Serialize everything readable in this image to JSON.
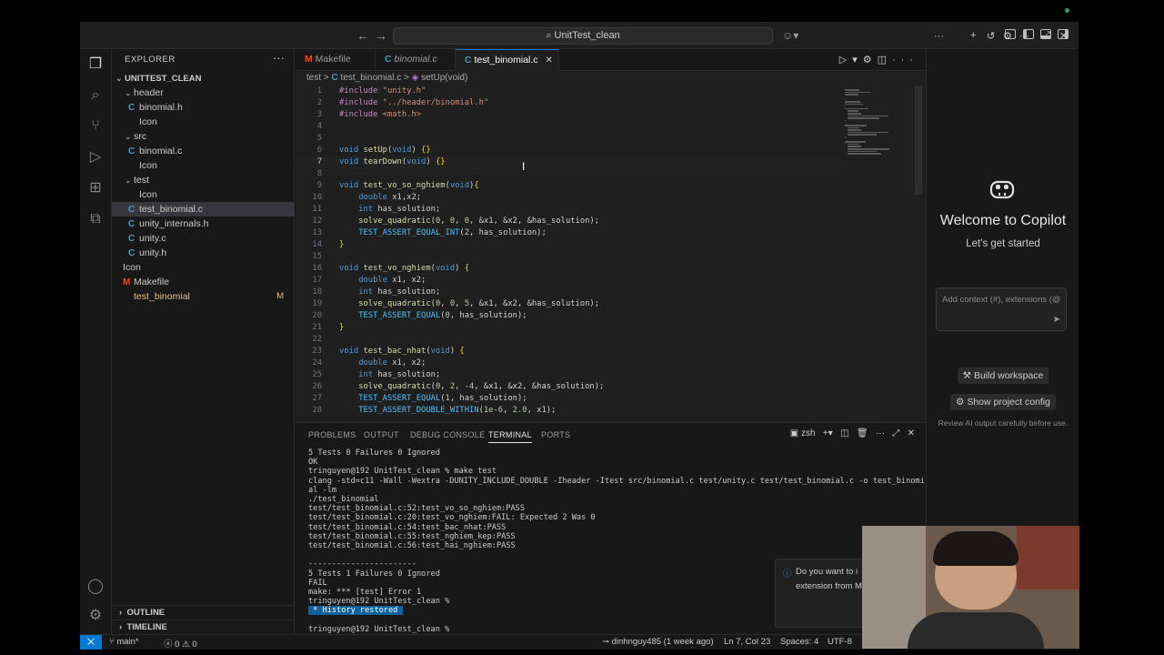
{
  "titlebar": {
    "search_text": "UnitTest_clean"
  },
  "explorer": {
    "title": "EXPLORER",
    "root": "UNITTEST_CLEAN",
    "items": [
      {
        "label": "header",
        "type": "folder",
        "depth": 1
      },
      {
        "label": "binomial.h",
        "type": "c",
        "depth": 2
      },
      {
        "label": "Icon",
        "type": "file",
        "depth": 2
      },
      {
        "label": "src",
        "type": "folder",
        "depth": 1
      },
      {
        "label": "binomial.c",
        "type": "c",
        "depth": 2
      },
      {
        "label": "Icon",
        "type": "file",
        "depth": 2
      },
      {
        "label": "test",
        "type": "folder",
        "depth": 1
      },
      {
        "label": "Icon",
        "type": "file",
        "depth": 2
      },
      {
        "label": "test_binomial.c",
        "type": "c",
        "depth": 2
      },
      {
        "label": "unity_internals.h",
        "type": "c",
        "depth": 2
      },
      {
        "label": "unity.c",
        "type": "c",
        "depth": 2
      },
      {
        "label": "unity.h",
        "type": "c",
        "depth": 2
      },
      {
        "label": "Icon",
        "type": "file",
        "depth": 1
      },
      {
        "label": "Makefile",
        "type": "m",
        "depth": 1
      },
      {
        "label": "test_binomial",
        "type": "file",
        "depth": 1,
        "badge": "M"
      }
    ],
    "outline": "OUTLINE",
    "timeline": "TIMELINE"
  },
  "tabs": [
    {
      "label": "Makefile",
      "icon": "M"
    },
    {
      "label": "binomial.c",
      "icon": "C"
    },
    {
      "label": "test_binomial.c",
      "icon": "C"
    }
  ],
  "breadcrumb": {
    "folder": "test",
    "sep": ">",
    "file": "test_binomial.c",
    "symbol": "setUp(void)"
  },
  "code": [
    {
      "n": "1",
      "t": "#include \"unity.h\""
    },
    {
      "n": "2",
      "t": "#include \"../header/binomial.h\""
    },
    {
      "n": "3",
      "t": "#include <math.h>"
    },
    {
      "n": "4",
      "t": ""
    },
    {
      "n": "5",
      "t": ""
    },
    {
      "n": "6",
      "t": "void setUp(void) {}"
    },
    {
      "n": "7",
      "t": "void tearDown(void) {}"
    },
    {
      "n": "8",
      "t": ""
    },
    {
      "n": "9",
      "t": "void test_vo_so_nghiem(void){"
    },
    {
      "n": "10",
      "t": "    double x1,x2;"
    },
    {
      "n": "11",
      "t": "    int has_solution;"
    },
    {
      "n": "12",
      "t": "    solve_quadratic(0, 0, 0, &x1, &x2, &has_solution);"
    },
    {
      "n": "13",
      "t": "    TEST_ASSERT_EQUAL_INT(2, has_solution);"
    },
    {
      "n": "14",
      "t": "}"
    },
    {
      "n": "15",
      "t": ""
    },
    {
      "n": "16",
      "t": "void test_vo_nghiem(void) {"
    },
    {
      "n": "17",
      "t": "    double x1, x2;"
    },
    {
      "n": "18",
      "t": "    int has_solution;"
    },
    {
      "n": "19",
      "t": "    solve_quadratic(0, 0, 5, &x1, &x2, &has_solution);"
    },
    {
      "n": "20",
      "t": "    TEST_ASSERT_EQUAL(0, has_solution);"
    },
    {
      "n": "21",
      "t": "}"
    },
    {
      "n": "22",
      "t": ""
    },
    {
      "n": "23",
      "t": "void test_bac_nhat(void) {"
    },
    {
      "n": "24",
      "t": "    double x1, x2;"
    },
    {
      "n": "25",
      "t": "    int has_solution;"
    },
    {
      "n": "26",
      "t": "    solve_quadratic(0, 2, -4, &x1, &x2, &has_solution);"
    },
    {
      "n": "27",
      "t": "    TEST_ASSERT_EQUAL(1, has_solution);"
    },
    {
      "n": "28",
      "t": "    TEST_ASSERT_DOUBLE_WITHIN(1e-6, 2.0, x1);"
    }
  ],
  "panel": {
    "tabs": [
      "PROBLEMS",
      "OUTPUT",
      "DEBUG CONSOLE",
      "TERMINAL",
      "PORTS"
    ],
    "shell": "zsh"
  },
  "terminal": [
    "5 Tests 0 Failures 0 Ignored",
    "OK",
    "tringuyen@192 UnitTest_clean % make test",
    "clang -std=c11 -Wall -Wextra -DUNITY_INCLUDE_DOUBLE -Iheader -Itest src/binomial.c test/unity.c test/test_binomial.c -o test_binomi",
    "al -lm",
    "./test_binomial",
    "test/test_binomial.c:52:test_vo_so_nghiem:PASS",
    "test/test_binomial.c:20:test_vo_nghiem:FAIL: Expected 2 Was 0",
    "test/test_binomial.c:54:test_bac_nhat:PASS",
    "test/test_binomial.c:55:test_nghiem_kep:PASS",
    "test/test_binomial.c:56:test_hai_nghiem:PASS",
    "",
    "-----------------------",
    "5 Tests 1 Failures 0 Ignored",
    "FAIL",
    "make: *** [test] Error 1",
    "tringuyen@192 UnitTest_clean %"
  ],
  "terminal_history": "History restored",
  "terminal_prompt": "tringuyen@192 UnitTest_clean %",
  "copilot": {
    "welcome": "Welcome to Copilot",
    "subtitle": "Let's get started",
    "input_placeholder": "Add context (#), extensions (@",
    "build_workspace": "Build workspace",
    "show_config": "Show project config",
    "review": "Review AI output carefully before use."
  },
  "notification": {
    "line1": "Do you want to i",
    "line2": "extension from M"
  },
  "status": {
    "branch": "main*",
    "problems": "0",
    "warnings": "0",
    "blame": "dinhnguy485 (1 week ago)",
    "position": "Ln 7, Col 23",
    "spaces": "Spaces: 4",
    "encoding": "UTF-8"
  },
  "colors": {
    "accent": "#0078d4",
    "modified": "#e2c08d",
    "c_icon": "#519aba"
  }
}
